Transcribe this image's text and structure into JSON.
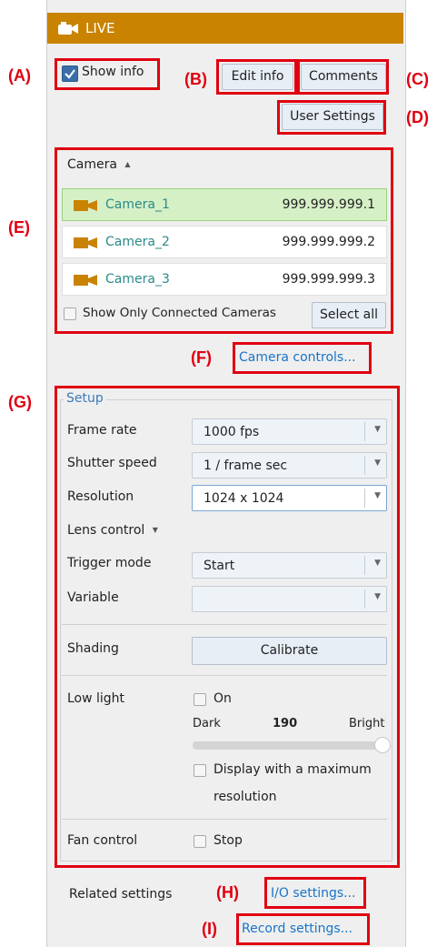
{
  "header": {
    "title": "LIVE"
  },
  "tags": {
    "a": "(A)",
    "b": "(B)",
    "c": "(C)",
    "d": "(D)",
    "e": "(E)",
    "f": "(F)",
    "g": "(G)",
    "h": "(H)",
    "i": "(I)"
  },
  "top": {
    "show_info_label": "Show info",
    "show_info_checked": true,
    "edit_info_label": "Edit info",
    "comments_label": "Comments",
    "user_settings_label": "User Settings"
  },
  "cameras": {
    "header": "Camera",
    "sort_glyph": "▲",
    "items": [
      {
        "name": "Camera_1",
        "ip": "999.999.999.1",
        "selected": true
      },
      {
        "name": "Camera_2",
        "ip": "999.999.999.2",
        "selected": false
      },
      {
        "name": "Camera_3",
        "ip": "999.999.999.3",
        "selected": false
      }
    ],
    "show_only_connected_label": "Show Only Connected Cameras",
    "select_all_label": "Select all",
    "camera_controls_link": "Camera controls..."
  },
  "setup": {
    "legend": "Setup",
    "frame_rate": {
      "label": "Frame rate",
      "value": "1000 fps"
    },
    "shutter_speed": {
      "label": "Shutter speed",
      "value": "1 / frame sec"
    },
    "resolution": {
      "label": "Resolution",
      "value": "1024 x 1024"
    },
    "lens_control": {
      "label": "Lens control",
      "glyph": "▼"
    },
    "trigger_mode": {
      "label": "Trigger mode",
      "value": "Start"
    },
    "variable": {
      "label": "Variable",
      "value": ""
    },
    "shading": {
      "label": "Shading",
      "button": "Calibrate"
    },
    "low_light": {
      "label": "Low light",
      "on_label": "On",
      "dark_label": "Dark",
      "value": "190",
      "bright_label": "Bright",
      "slider_fraction": 1.0,
      "display_max_res_line1": "Display with a maximum",
      "display_max_res_line2": "resolution"
    },
    "fan_control": {
      "label": "Fan control",
      "stop_label": "Stop"
    }
  },
  "related": {
    "label": "Related settings",
    "io_link": "I/O settings...",
    "record_link": "Record settings..."
  },
  "colors": {
    "title_bar": "#c98300",
    "highlight_red": "#e00010",
    "link_blue": "#1874c9",
    "selected_row": "#d6f0c6"
  }
}
